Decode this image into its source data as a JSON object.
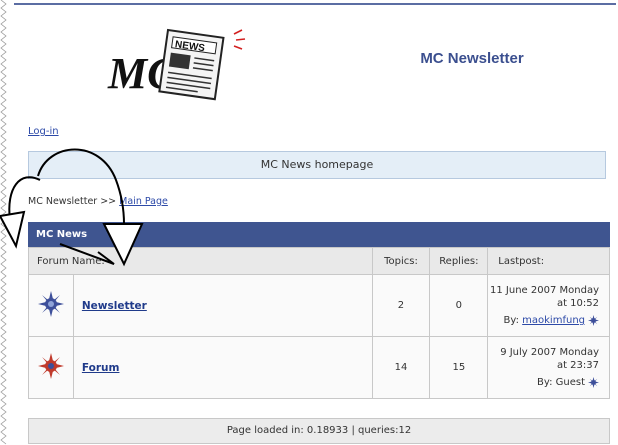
{
  "site": {
    "logo_text": "MC",
    "logo_news": "NEWS",
    "title": "MC Newsletter",
    "login_label": "Log-in",
    "homepage_label": "MC News homepage"
  },
  "breadcrumb": {
    "root": "MC Newsletter >> ",
    "link": "Main Page"
  },
  "category": {
    "name": "MC News"
  },
  "columns": {
    "forum_name": "Forum Name:",
    "topics": "Topics:",
    "replies": "Replies:",
    "lastpost": "Lastpost:"
  },
  "forums": [
    {
      "name": "Newsletter",
      "topics": "2",
      "replies": "0",
      "last_date": "11 June 2007 Monday",
      "last_time": "at 10:52",
      "by_label": "By: ",
      "author": "maokimfung",
      "icon": "sun-icon",
      "icon_color": "#3d4f9a"
    },
    {
      "name": "Forum",
      "topics": "14",
      "replies": "15",
      "last_date": "9 July 2007 Monday",
      "last_time": "at 23:37",
      "by_label": "By: ",
      "author": "Guest",
      "icon": "sun-icon",
      "icon_color": "#c0392b"
    }
  ],
  "footer": {
    "text": "Page loaded in: 0.18933 | queries:12"
  },
  "colors": {
    "header_bar": "#3f5590",
    "title": "#3b4f8f",
    "banner_bg": "#e4eef7",
    "link": "#2d4aa8"
  }
}
